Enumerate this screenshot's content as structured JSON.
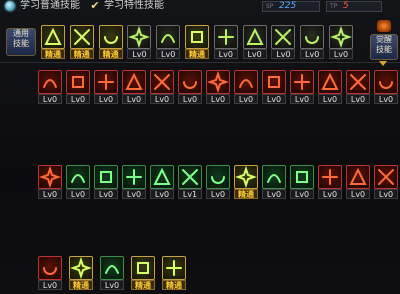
{
  "topbar": {
    "learn_normal_label": "学习普通技能",
    "learn_special_label": "学习特性技能",
    "sp_tag": "SP",
    "sp_value": "225",
    "sp_color": "#5aa9ff",
    "tp_tag": "TP",
    "tp_value": "5",
    "tp_color": "#ff5a3a"
  },
  "categories": {
    "general": "通用\n技能",
    "hero": "觉醒\n技能"
  },
  "labels": {
    "master": "精通",
    "lv0": "Lv0",
    "lv1": "Lv1"
  },
  "colors": {
    "accent_gold": "#c9a13d",
    "level_text": "#e6e6e6",
    "master_text": "#ffcc33"
  },
  "rows": [
    {
      "row": "general",
      "skills": [
        {
          "icon": "punch-icon",
          "label": "精通",
          "master": true,
          "frame": "gold"
        },
        {
          "icon": "tiger-icon",
          "label": "精通",
          "master": true,
          "frame": "gold"
        },
        {
          "icon": "kick-icon",
          "label": "精通",
          "master": true,
          "frame": "gold"
        },
        {
          "icon": "wing-icon",
          "label": "Lv0",
          "master": false,
          "frame": "grey"
        },
        {
          "icon": "star-icon",
          "label": "Lv0",
          "master": false,
          "frame": "grey"
        },
        {
          "icon": "burst-icon",
          "label": "精通",
          "master": true,
          "frame": "gold"
        },
        {
          "icon": "runner-icon",
          "label": "Lv0",
          "master": false,
          "frame": "grey"
        },
        {
          "icon": "bolt-icon",
          "label": "Lv0",
          "master": false,
          "frame": "grey"
        },
        {
          "icon": "coin-icon",
          "label": "Lv0",
          "master": false,
          "frame": "grey"
        },
        {
          "icon": "idol-icon",
          "label": "Lv0",
          "master": false,
          "frame": "grey"
        },
        {
          "icon": "leaf-icon",
          "label": "Lv0",
          "master": false,
          "frame": "grey"
        }
      ]
    },
    {
      "row": "r1",
      "skills": [
        {
          "icon": "slash-icon",
          "label": "Lv0",
          "master": false,
          "frame": "red"
        },
        {
          "icon": "cross-icon",
          "label": "Lv0",
          "master": false,
          "frame": "red"
        },
        {
          "icon": "crescent-icon",
          "label": "Lv0",
          "master": false,
          "frame": "red"
        },
        {
          "icon": "blade-icon",
          "label": "Lv0",
          "master": false,
          "frame": "red"
        },
        {
          "icon": "stab-icon",
          "label": "Lv0",
          "master": false,
          "frame": "red"
        },
        {
          "icon": "thrust-icon",
          "label": "Lv0",
          "master": false,
          "frame": "red"
        },
        {
          "icon": "dagger-icon",
          "label": "Lv0",
          "master": false,
          "frame": "red"
        },
        {
          "icon": "spin-icon",
          "label": "Lv0",
          "master": false,
          "frame": "red"
        },
        {
          "icon": "leap-icon",
          "label": "Lv0",
          "master": false,
          "frame": "red"
        },
        {
          "icon": "axe-icon",
          "label": "Lv0",
          "master": false,
          "frame": "red"
        },
        {
          "icon": "hook-icon",
          "label": "Lv0",
          "master": false,
          "frame": "red"
        },
        {
          "icon": "swirl-icon",
          "label": "Lv0",
          "master": false,
          "frame": "red"
        },
        {
          "icon": "claw-icon",
          "label": "Lv0",
          "master": false,
          "frame": "red"
        }
      ]
    },
    {
      "row": "r2",
      "skills": [
        {
          "icon": "shuriken-icon",
          "label": "Lv0",
          "master": false,
          "frame": "red"
        },
        {
          "icon": "crescent-icon",
          "label": "Lv0",
          "master": false,
          "frame": "green"
        },
        {
          "icon": "spiral-icon",
          "label": "Lv0",
          "master": false,
          "frame": "green"
        },
        {
          "icon": "fist-icon",
          "label": "Lv0",
          "master": false,
          "frame": "green"
        },
        {
          "icon": "dash-icon",
          "label": "Lv0",
          "master": false,
          "frame": "green"
        },
        {
          "icon": "web-icon",
          "label": "Lv1",
          "master": false,
          "frame": "green"
        },
        {
          "icon": "dragon-icon",
          "label": "Lv0",
          "master": false,
          "frame": "green"
        },
        {
          "icon": "flower-icon",
          "label": "精通",
          "master": true,
          "frame": "gold"
        },
        {
          "icon": "talon-icon",
          "label": "Lv0",
          "master": false,
          "frame": "green"
        },
        {
          "icon": "fang-icon",
          "label": "Lv0",
          "master": false,
          "frame": "green"
        },
        {
          "icon": "tornado-icon",
          "label": "Lv0",
          "master": false,
          "frame": "red"
        },
        {
          "icon": "chain-icon",
          "label": "Lv0",
          "master": false,
          "frame": "red"
        },
        {
          "icon": "rift-icon",
          "label": "Lv0",
          "master": false,
          "frame": "red"
        }
      ]
    },
    {
      "row": "r3",
      "skills": [
        {
          "icon": "uppercut-icon",
          "label": "Lv0",
          "master": false,
          "frame": "red"
        },
        {
          "icon": "serpent-icon",
          "label": "精通",
          "master": true,
          "frame": "gold"
        },
        {
          "icon": "vortex-icon",
          "label": "Lv0",
          "master": false,
          "frame": "green"
        },
        {
          "icon": "whirl-icon",
          "label": "精通",
          "master": true,
          "frame": "gold"
        },
        {
          "icon": "phoenix-icon",
          "label": "精通",
          "master": true,
          "frame": "gold"
        }
      ]
    }
  ]
}
